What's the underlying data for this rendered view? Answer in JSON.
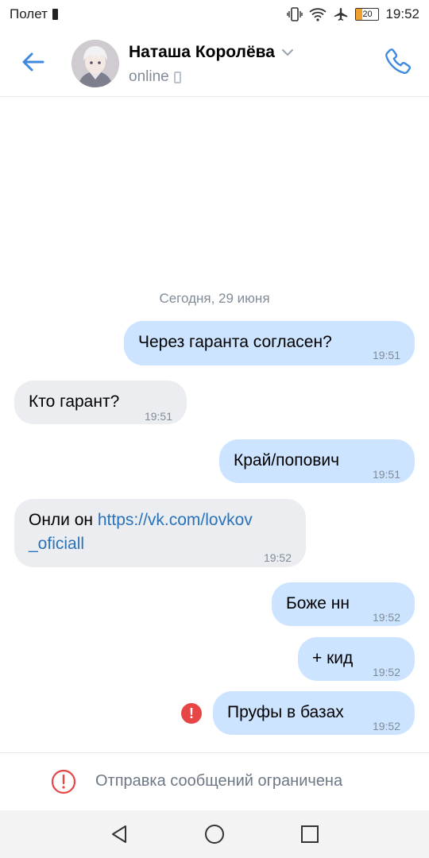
{
  "status_bar": {
    "mode": "Полет",
    "battery": "20",
    "time": "19:52"
  },
  "header": {
    "contact_name": "Наташа Королёва",
    "presence": "online",
    "icons": [
      "back-arrow-icon",
      "chevron-down-icon",
      "mobile-icon",
      "phone-icon"
    ]
  },
  "chat": {
    "date_separator": "Сегодня, 29 июня",
    "messages": [
      {
        "direction": "out",
        "text": "Через гаранта согласен?",
        "time": "19:51"
      },
      {
        "direction": "in",
        "text": "Кто гарант?",
        "time": "19:51"
      },
      {
        "direction": "out",
        "text": "Край/попович",
        "time": "19:51"
      },
      {
        "direction": "in",
        "text_prefix": "Онли он ",
        "link_line1": "https://vk.com/lovkov",
        "link_line2": "_oficiall",
        "time": "19:52"
      },
      {
        "direction": "out",
        "text": "Боже нн",
        "time": "19:52"
      },
      {
        "direction": "out",
        "text": "+ кид",
        "time": "19:52"
      },
      {
        "direction": "out",
        "text": "Пруфы в базах",
        "time": "19:52",
        "failed": true
      }
    ]
  },
  "footer": {
    "notice": "Отправка сообщений ограничена"
  },
  "colors": {
    "outgoing_bubble": "#cce4ff",
    "incoming_bubble": "#ebedf0",
    "accent": "#3f8ae0",
    "error": "#e64646",
    "link": "#2a72b9"
  }
}
